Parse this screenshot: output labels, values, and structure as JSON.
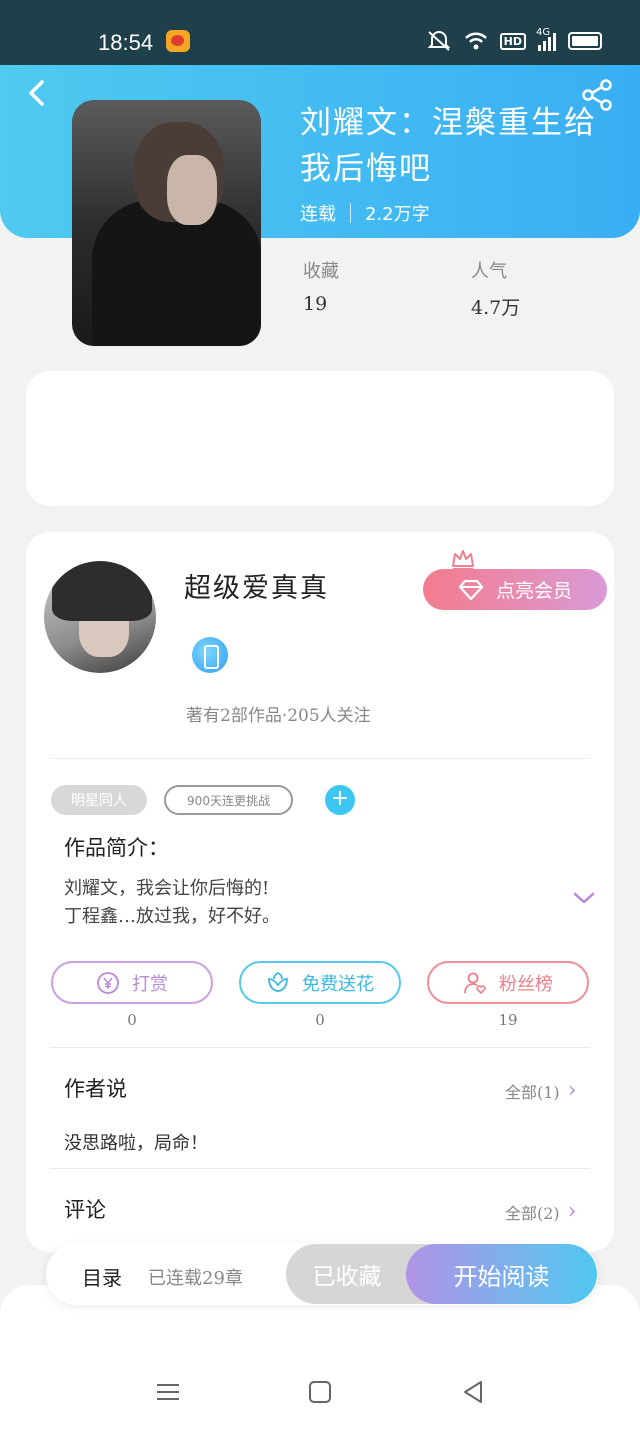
{
  "status_bar": {
    "time": "18:54",
    "hd": "HD",
    "network": "4G"
  },
  "book": {
    "title": "刘耀文：涅槃重生给我后悔吧",
    "status": "连载",
    "word_count": "2.2万字",
    "stats": [
      {
        "label": "收藏",
        "value": "19"
      },
      {
        "label": "人气",
        "value": "4.7万"
      }
    ]
  },
  "author": {
    "name": "超级爱真真",
    "stats": "著有2部作品·205人关注",
    "vip_button": "点亮会员"
  },
  "tags": [
    "明星同人",
    "900天连更挑战"
  ],
  "intro": {
    "title": "作品简介：",
    "lines": [
      "刘耀文，我会让你后悔的!",
      "丁程鑫…放过我，好不好。"
    ]
  },
  "actions": [
    {
      "label": "打赏",
      "count": "0"
    },
    {
      "label": "免费送花",
      "count": "0"
    },
    {
      "label": "粉丝榜",
      "count": "19"
    }
  ],
  "author_says": {
    "title": "作者说",
    "more": "全部(1)",
    "text": "没思路啦，局命！"
  },
  "comments": {
    "title": "评论",
    "more": "全部(2)"
  },
  "bottom": {
    "toc": "目录",
    "chapters": "已连载29章",
    "collected": "已收藏",
    "read": "开始阅读"
  },
  "colors": {
    "header": "#39aef3",
    "accent_purple": "#b98ad8",
    "accent_blue": "#3ab8e4",
    "accent_pink": "#ec7f89"
  }
}
